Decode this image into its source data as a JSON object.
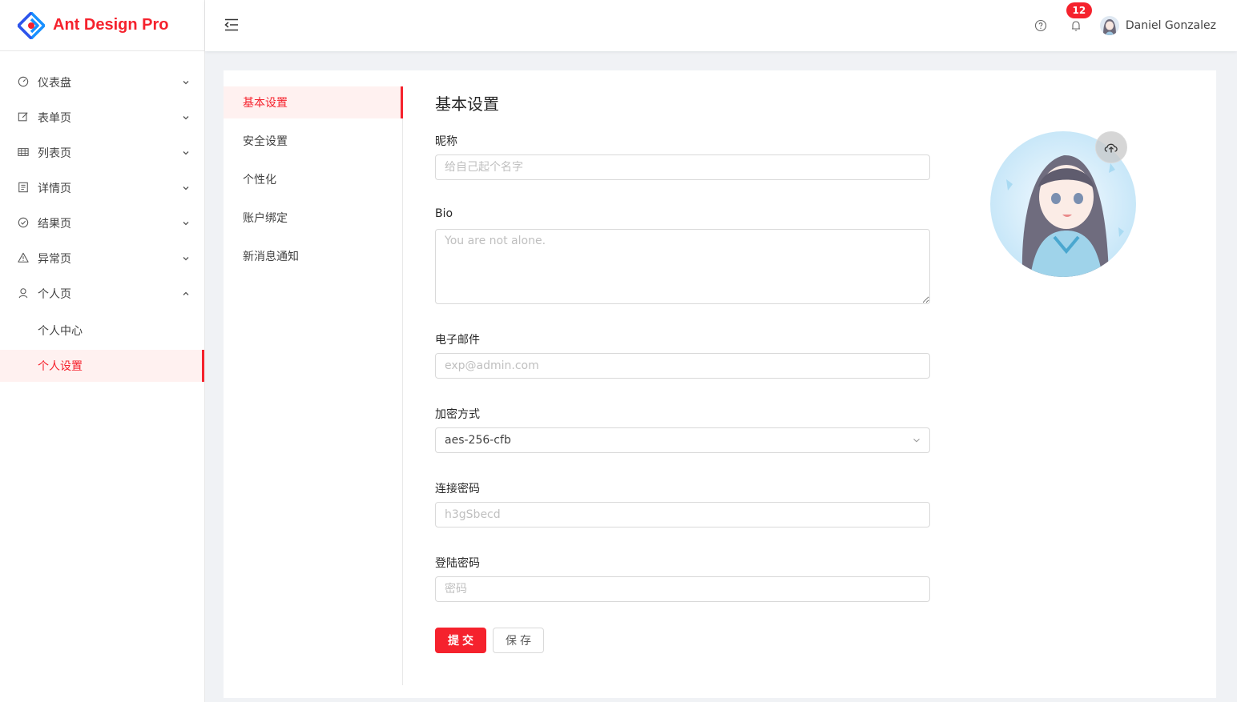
{
  "app": {
    "title": "Ant Design Pro"
  },
  "colors": {
    "accent": "#f5222d",
    "active_bg": "#fff1f0",
    "page_bg": "#f0f2f5"
  },
  "sidebar": {
    "items": [
      {
        "label": "仪表盘",
        "icon": "dashboard-icon",
        "expanded": false
      },
      {
        "label": "表单页",
        "icon": "form-icon",
        "expanded": false
      },
      {
        "label": "列表页",
        "icon": "table-icon",
        "expanded": false
      },
      {
        "label": "详情页",
        "icon": "profile-icon",
        "expanded": false
      },
      {
        "label": "结果页",
        "icon": "check-circle-icon",
        "expanded": false
      },
      {
        "label": "异常页",
        "icon": "warning-icon",
        "expanded": false
      },
      {
        "label": "个人页",
        "icon": "user-icon",
        "expanded": true
      }
    ],
    "sub_items": [
      {
        "label": "个人中心",
        "active": false
      },
      {
        "label": "个人设置",
        "active": true
      }
    ]
  },
  "header": {
    "notification_count": "12",
    "username": "Daniel Gonzalez"
  },
  "settings_menu": {
    "items": [
      {
        "label": "基本设置",
        "active": true
      },
      {
        "label": "安全设置",
        "active": false
      },
      {
        "label": "个性化",
        "active": false
      },
      {
        "label": "账户绑定",
        "active": false
      },
      {
        "label": "新消息通知",
        "active": false
      }
    ]
  },
  "form": {
    "title": "基本设置",
    "nickname": {
      "label": "昵称",
      "placeholder": "给自己起个名字"
    },
    "bio": {
      "label": "Bio",
      "placeholder": "You are not alone."
    },
    "email": {
      "label": "电子邮件",
      "placeholder": "exp@admin.com"
    },
    "encryption": {
      "label": "加密方式",
      "value": "aes-256-cfb"
    },
    "conn_password": {
      "label": "连接密码",
      "placeholder": "h3gSbecd"
    },
    "login_password": {
      "label": "登陆密码",
      "placeholder": "密码"
    },
    "submit_label": "提交",
    "save_label": "保存"
  }
}
